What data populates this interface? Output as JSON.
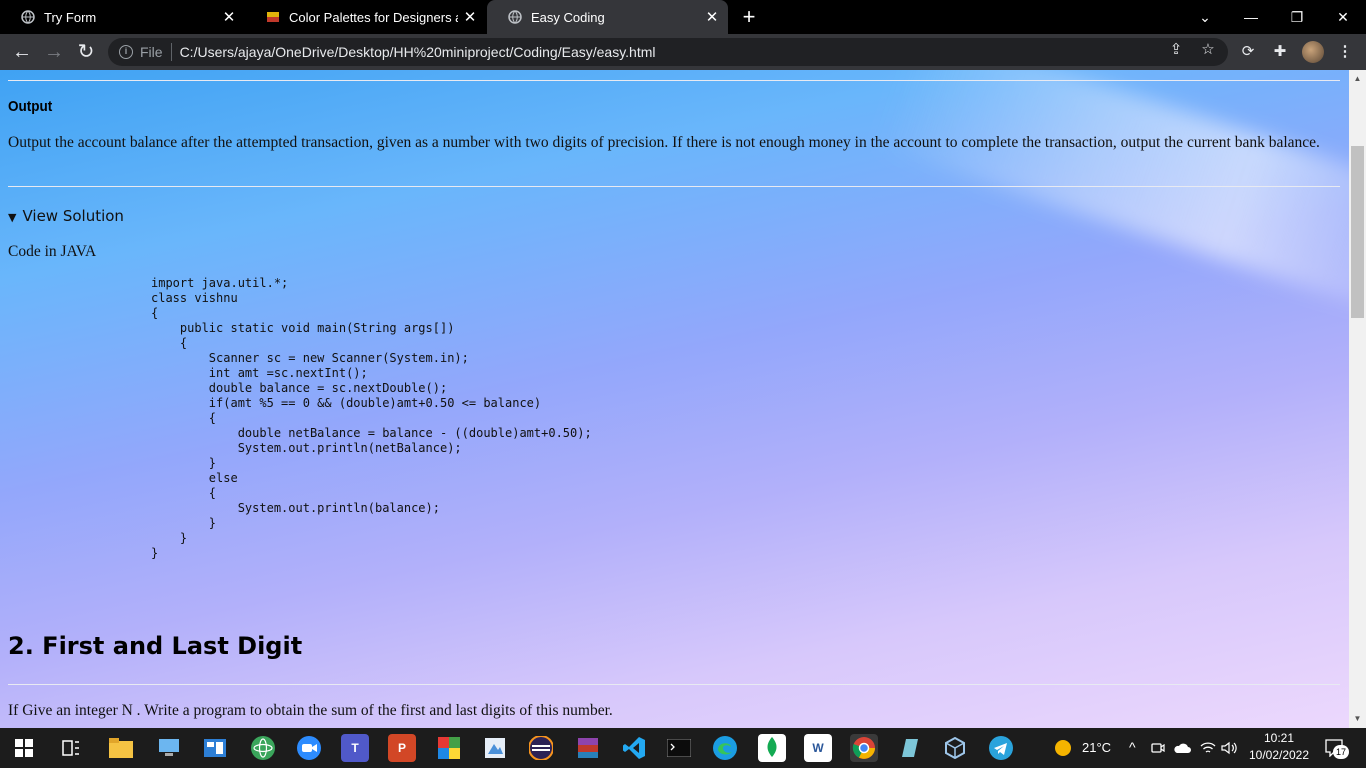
{
  "tabs": [
    {
      "title": "Try Form",
      "close": "✕"
    },
    {
      "title": "Color Palettes for Designers and Artists",
      "close": "✕"
    },
    {
      "title": "Easy Coding",
      "close": "✕"
    }
  ],
  "new_tab": "+",
  "window_controls": {
    "dropdown": "⌄",
    "minimize": "—",
    "restore": "❐",
    "close": "✕"
  },
  "toolbar": {
    "back": "←",
    "forward": "→",
    "reload": "↻",
    "site_info": "i",
    "scheme_label": "File",
    "url": "C:/Users/ajaya/OneDrive/Desktop/HH%20miniproject/Coding/Easy/easy.html",
    "share": "⇪",
    "bookmark": "☆",
    "extension1": "⟳",
    "extensions": "✚",
    "menu": "⋮"
  },
  "page": {
    "output_heading": "Output",
    "output_text": "Output the account balance after the attempted transaction, given as a number with two digits of precision. If there is not enough money in the account to complete the transaction, output the current bank balance.",
    "details_marker": "▼",
    "details_summary": "View Solution",
    "code_label": "Code in JAVA",
    "code": "import java.util.*;\nclass vishnu\n{\n    public static void main(String args[])\n    {\n        Scanner sc = new Scanner(System.in);\n        int amt =sc.nextInt();\n        double balance = sc.nextDouble();\n        if(amt %5 == 0 && (double)amt+0.50 <= balance)\n        {\n            double netBalance = balance - ((double)amt+0.50);\n            System.out.println(netBalance);\n        }\n        else\n        {\n            System.out.println(balance);\n        }\n    }\n}",
    "section2_title": "2. First and Last Digit",
    "section2_text": "If Give an integer N . Write a program to obtain the sum of the first and last digits of this number."
  },
  "scrollbar": {
    "up": "▲",
    "down": "▼"
  },
  "taskbar": {
    "apps": [
      "start",
      "task-view",
      "file-explorer",
      "this-pc",
      "windows-app",
      "atom",
      "zoom",
      "teams",
      "powerpoint",
      "minecraft",
      "paint",
      "eclipse",
      "winrar",
      "vscode",
      "terminal",
      "edge",
      "mongodb",
      "word",
      "chrome",
      "notes",
      "virtualbox",
      "telegram"
    ],
    "weather": "21°C",
    "tray_chevron": "^",
    "time": "10:21",
    "date": "10/02/2022",
    "notification_count": "17"
  }
}
